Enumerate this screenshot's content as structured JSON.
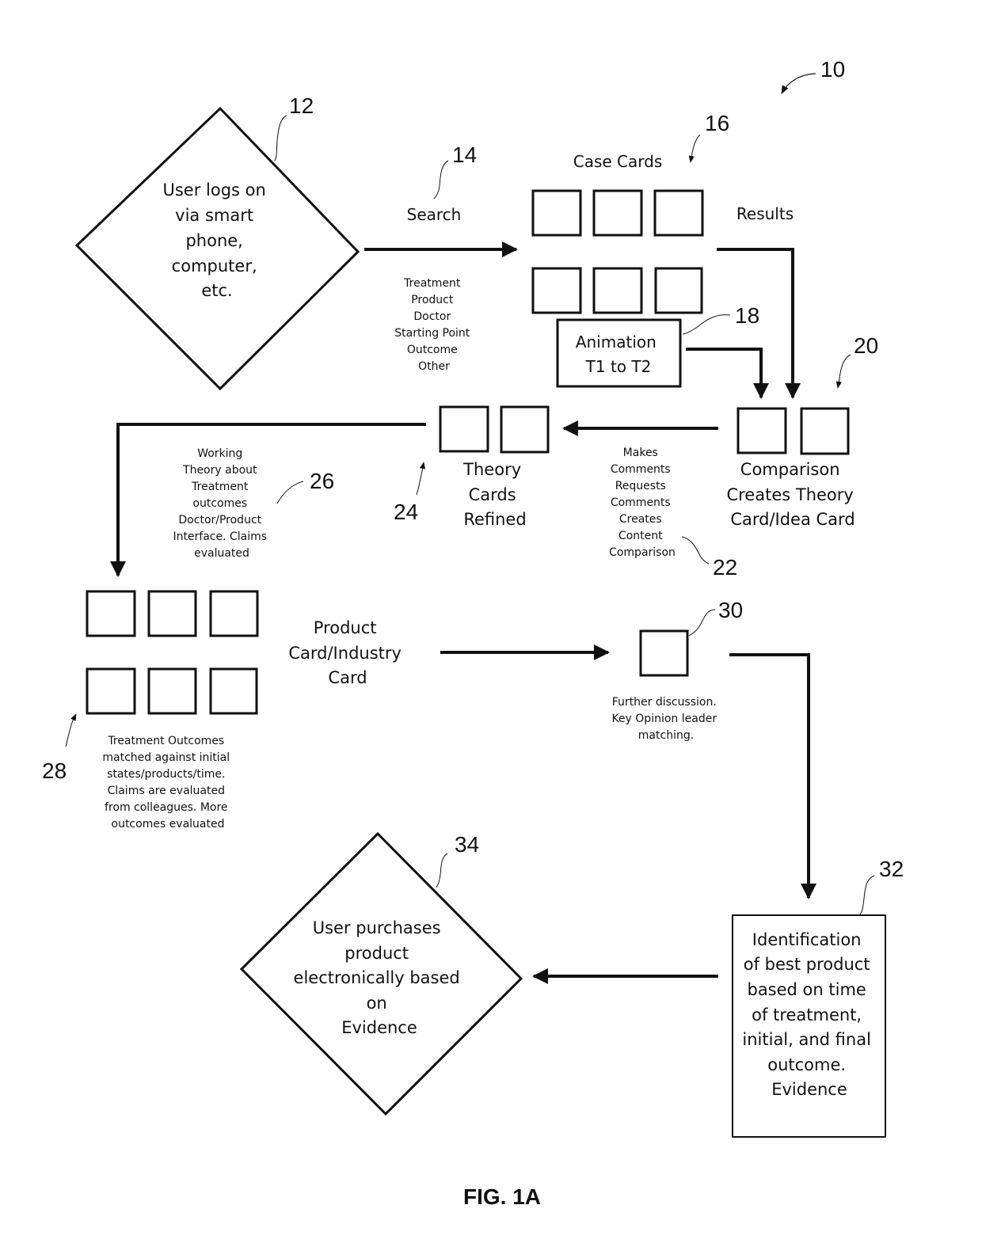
{
  "figure": {
    "caption": "FIG. 1A",
    "ref_system": "10"
  },
  "nodes": {
    "start": {
      "ref": "12",
      "lines": [
        "User logs on",
        "via smart",
        "phone,",
        "computer,",
        "etc."
      ]
    },
    "search": {
      "ref": "14",
      "label": "Search",
      "criteria": [
        "Treatment",
        "Product",
        "Doctor",
        "Starting Point",
        "Outcome",
        "Other"
      ]
    },
    "case_cards": {
      "ref": "16",
      "title": "Case Cards",
      "side_label": "Results",
      "card_count": 6
    },
    "animation": {
      "ref": "18",
      "lines": [
        "Animation",
        "T1 to T2"
      ]
    },
    "comparison": {
      "ref": "20",
      "lines": [
        "Comparison",
        "Creates Theory",
        "Card/Idea Card"
      ],
      "card_count": 2
    },
    "comments": {
      "ref": "22",
      "lines": [
        "Makes",
        "Comments",
        "Requests",
        "Comments",
        "Creates",
        "Content",
        "Comparison"
      ]
    },
    "theory_cards": {
      "ref": "24",
      "lines": [
        "Theory",
        "Cards",
        "Refined"
      ],
      "card_count": 2
    },
    "working_theory": {
      "ref": "26",
      "lines": [
        "Working",
        "Theory about",
        "Treatment",
        "outcomes",
        "Doctor/Product",
        "Interface.  Claims",
        "evaluated"
      ]
    },
    "product_cards": {
      "ref": "28",
      "label_lines": [
        "Product",
        "Card/Industry",
        "Card"
      ],
      "caption_lines": [
        "Treatment Outcomes",
        "matched against initial",
        "states/products/time.",
        "Claims are evaluated",
        "from colleagues.  More",
        "outcomes evaluated"
      ],
      "card_count": 6
    },
    "discussion": {
      "ref": "30",
      "lines": [
        "Further discussion.",
        "Key Opinion leader",
        "matching."
      ]
    },
    "identification": {
      "ref": "32",
      "lines": [
        "Identification",
        "of best product",
        "based on time",
        "of treatment,",
        "initial, and final",
        "outcome.",
        "Evidence"
      ]
    },
    "purchase": {
      "ref": "34",
      "lines": [
        "User purchases",
        "product",
        "electronically based",
        "on",
        "Evidence"
      ]
    }
  }
}
